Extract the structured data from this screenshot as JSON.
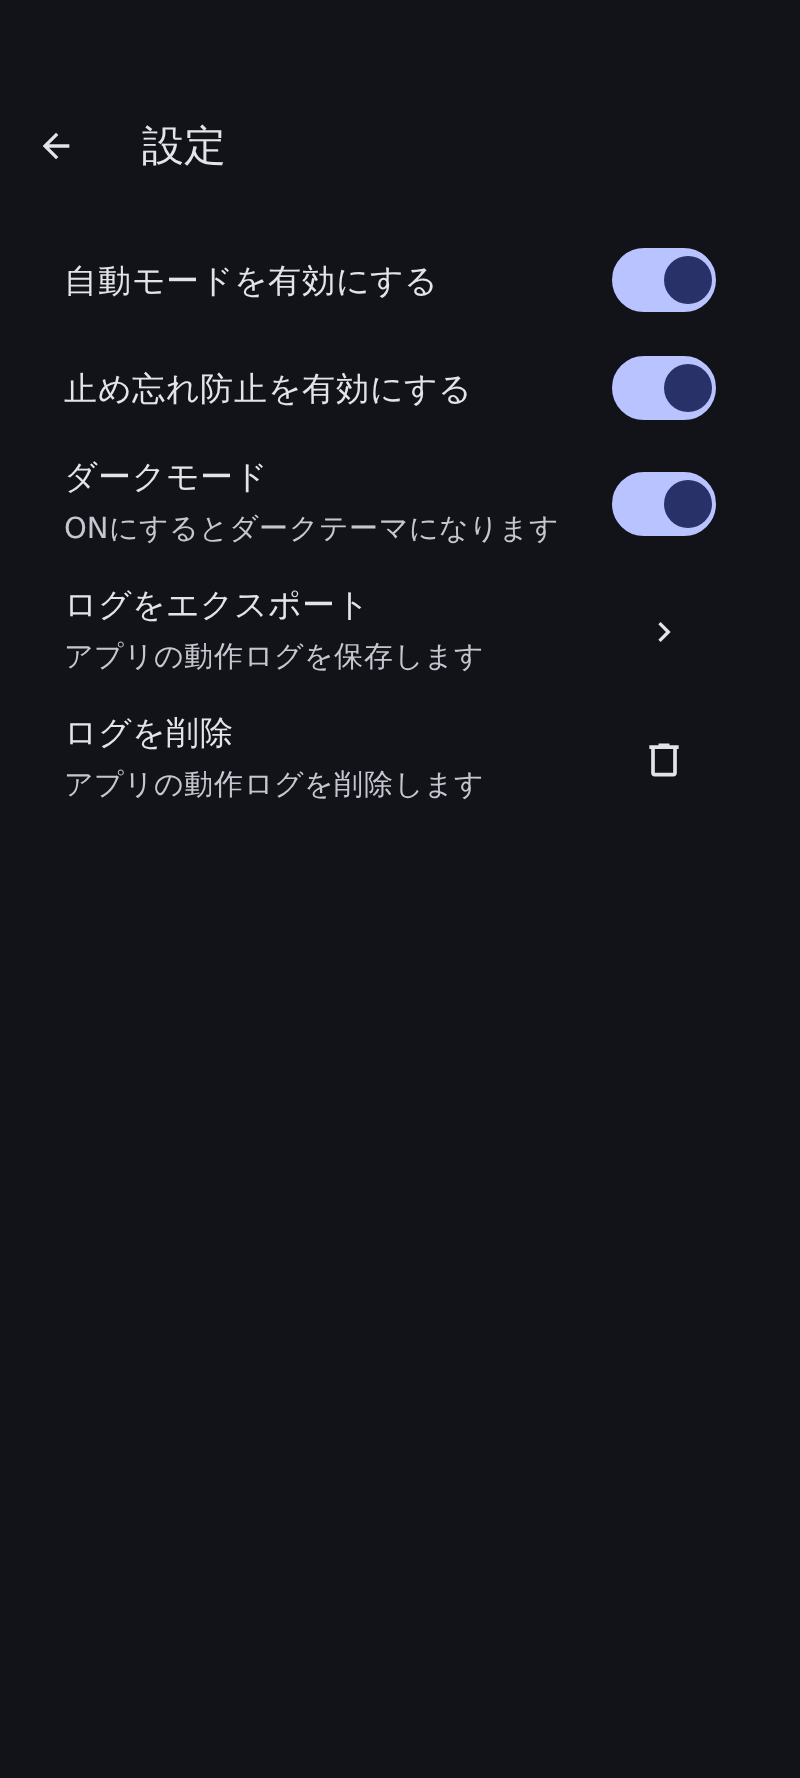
{
  "app_bar": {
    "title": "設定"
  },
  "settings": [
    {
      "kind": "toggle",
      "title": "自動モードを有効にする",
      "on": true
    },
    {
      "kind": "toggle",
      "title": "止め忘れ防止を有効にする",
      "on": true
    },
    {
      "kind": "toggle",
      "title": "ダークモード",
      "subtitle": "ONにするとダークテーマになります",
      "on": true
    },
    {
      "kind": "chevron",
      "title": "ログをエクスポート",
      "subtitle": "アプリの動作ログを保存します"
    },
    {
      "kind": "trash",
      "title": "ログを削除",
      "subtitle": "アプリの動作ログを削除します"
    }
  ]
}
